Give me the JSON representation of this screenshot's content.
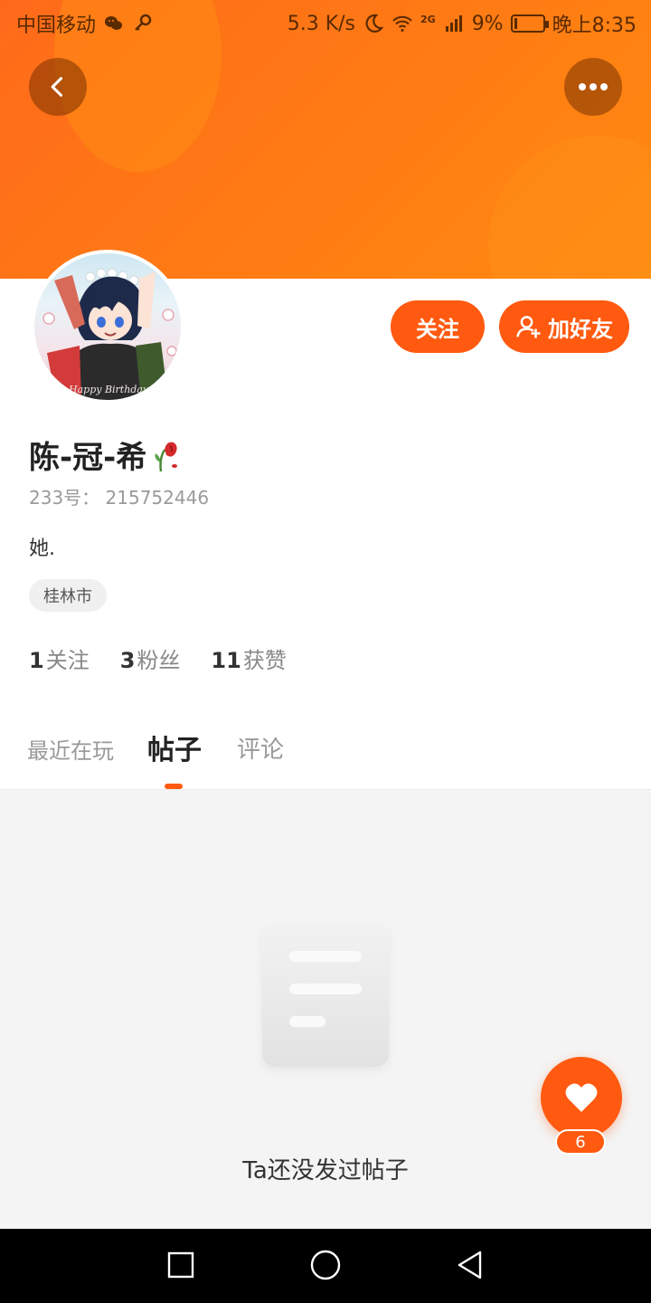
{
  "status_bar": {
    "carrier": "中国移动",
    "speed": "5.3 K/s",
    "network": "2G",
    "battery": "9%",
    "battery_level": 0.09,
    "time": "晚上8:35"
  },
  "header": {
    "back_icon": "chevron-left-icon",
    "more_icon": "more-horizontal-icon"
  },
  "actions": {
    "follow_label": "关注",
    "add_friend_label": "加好友",
    "accent_color": "#ff5a10"
  },
  "profile": {
    "name": "陈-冠-希",
    "uid": "233号： 215752446",
    "bio": "她.",
    "location_tag": "桂林市",
    "avatar_caption": "Happy Birthday"
  },
  "stats": [
    {
      "value": "1",
      "label": "关注"
    },
    {
      "value": "3",
      "label": "粉丝"
    },
    {
      "value": "11",
      "label": "获赞"
    }
  ],
  "tabs": [
    {
      "label": "最近在玩"
    },
    {
      "label": "帖子"
    },
    {
      "label": "评论"
    }
  ],
  "active_tab": "帖子",
  "empty_state": {
    "message": "Ta还没发过帖子"
  },
  "like": {
    "count": "6"
  }
}
